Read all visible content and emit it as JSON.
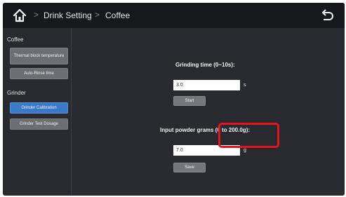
{
  "header": {
    "home_icon": "home-icon",
    "breadcrumb": [
      "Drink Setting",
      "Coffee"
    ],
    "back_icon": "back-arrow-icon"
  },
  "sidebar": {
    "group_coffee": "Coffee",
    "thermal_block": "Thermal block temperature",
    "auto_rinse": "Auto-Rinse time",
    "group_grinder": "Grinder",
    "grinder_calibration": "Grinder Calibration",
    "grinder_test": "Grinder Test Dosage"
  },
  "main": {
    "grinding_label": "Grinding time (0~10s):",
    "grinding_value": "3.0",
    "grinding_unit": "s",
    "start_label": "Start",
    "powder_label": "Input powder grams (0 to 200.0g):",
    "powder_value": "7.0",
    "powder_unit": "g",
    "save_label": "Save"
  },
  "colors": {
    "accent": "#3a78c8",
    "highlight": "#e8121f"
  }
}
